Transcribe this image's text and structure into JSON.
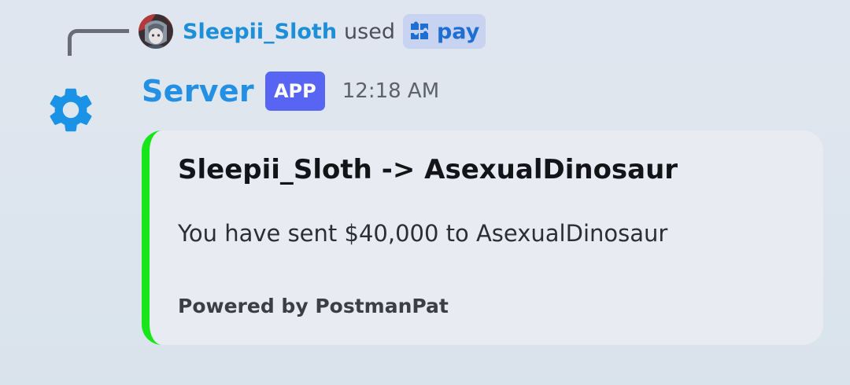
{
  "reply": {
    "username": "Sleepii_Sloth",
    "action_text": "used",
    "command": "pay",
    "command_icon": "puzzle-icon",
    "user_color": "#1c8fd8",
    "command_color": "#1f6fd2"
  },
  "message": {
    "author": "Server",
    "author_color": "#2390e3",
    "author_icon": "gear-icon",
    "badge": "APP",
    "badge_color": "#5865f2",
    "timestamp": "12:18 AM"
  },
  "embed": {
    "accent_color": "#19e619",
    "title": "Sleepii_Sloth -> AsexualDinosaur",
    "description": "You have sent $40,000 to AsexualDinosaur",
    "footer": "Powered by PostmanPat"
  }
}
